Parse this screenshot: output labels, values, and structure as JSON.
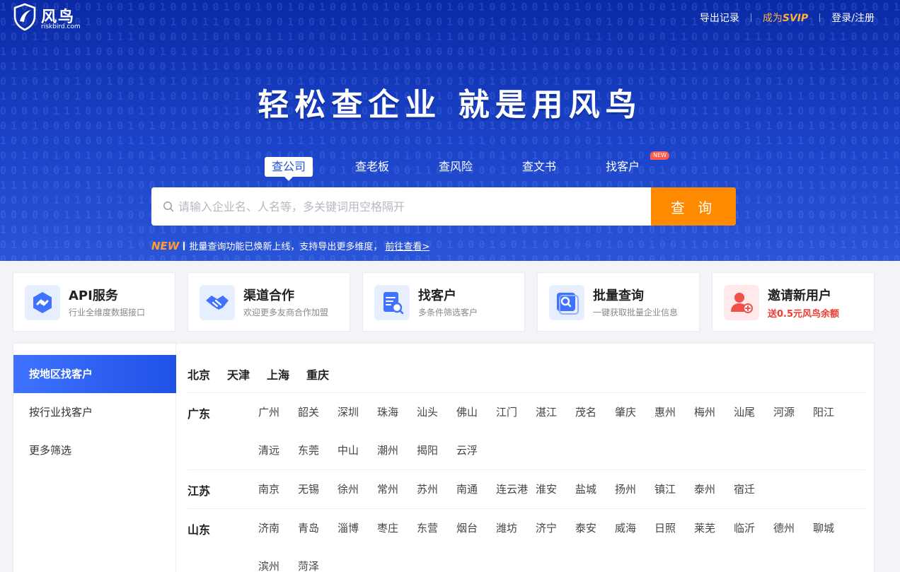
{
  "brand": {
    "name": "风鸟",
    "domain": "riskbird.com"
  },
  "top_links": {
    "export": "导出记录",
    "svip_prefix": "成为",
    "svip_word": "SVIP",
    "login": "登录/注册"
  },
  "colors": {
    "accent": "#1f51e6",
    "orange": "#ff8a00",
    "new_red": "#ff5a4a"
  },
  "hero": {
    "slogan": "轻松查企业 就是用风鸟"
  },
  "tabs": [
    {
      "label": "查公司",
      "active": true
    },
    {
      "label": "查老板"
    },
    {
      "label": "查风险"
    },
    {
      "label": "查文书"
    },
    {
      "label": "找客户",
      "badge": "NEW"
    }
  ],
  "search": {
    "placeholder": "请输入企业名、人名等，多关键词用空格隔开",
    "button": "查 询",
    "icon": "search-icon"
  },
  "notice": {
    "tag": "NEW",
    "text": "批量查询功能已焕新上线，支持导出更多维度，",
    "link": "前往查看>"
  },
  "cards": [
    {
      "title": "API服务",
      "sub": "行业全维度数据接口",
      "icon": "api-icon"
    },
    {
      "title": "渠道合作",
      "sub": "欢迎更多友商合作加盟",
      "icon": "handshake-icon"
    },
    {
      "title": "找客户",
      "sub": "多条件筛选客户",
      "icon": "document-search-icon"
    },
    {
      "title": "批量查询",
      "sub": "一键获取批量企业信息",
      "icon": "batch-search-icon"
    },
    {
      "title": "邀请新用户",
      "sub": "送0.5元风鸟余额",
      "icon": "invite-user-icon"
    }
  ],
  "sidebar": [
    {
      "label": "按地区找客户",
      "active": true
    },
    {
      "label": "按行业找客户"
    },
    {
      "label": "更多筛选"
    }
  ],
  "regions": {
    "municipalities": [
      "北京",
      "天津",
      "上海",
      "重庆"
    ],
    "provinces": [
      {
        "name": "广东",
        "cities": [
          "广州",
          "韶关",
          "深圳",
          "珠海",
          "汕头",
          "佛山",
          "江门",
          "湛江",
          "茂名",
          "肇庆",
          "惠州",
          "梅州",
          "汕尾",
          "河源",
          "阳江",
          "清远",
          "东莞",
          "中山",
          "潮州",
          "揭阳",
          "云浮"
        ]
      },
      {
        "name": "江苏",
        "cities": [
          "南京",
          "无锡",
          "徐州",
          "常州",
          "苏州",
          "南通",
          "连云港",
          "淮安",
          "盐城",
          "扬州",
          "镇江",
          "泰州",
          "宿迁"
        ]
      },
      {
        "name": "山东",
        "cities": [
          "济南",
          "青岛",
          "淄博",
          "枣庄",
          "东营",
          "烟台",
          "潍坊",
          "济宁",
          "泰安",
          "威海",
          "日照",
          "莱芜",
          "临沂",
          "德州",
          "聊城",
          "滨州",
          "菏泽"
        ]
      }
    ]
  }
}
